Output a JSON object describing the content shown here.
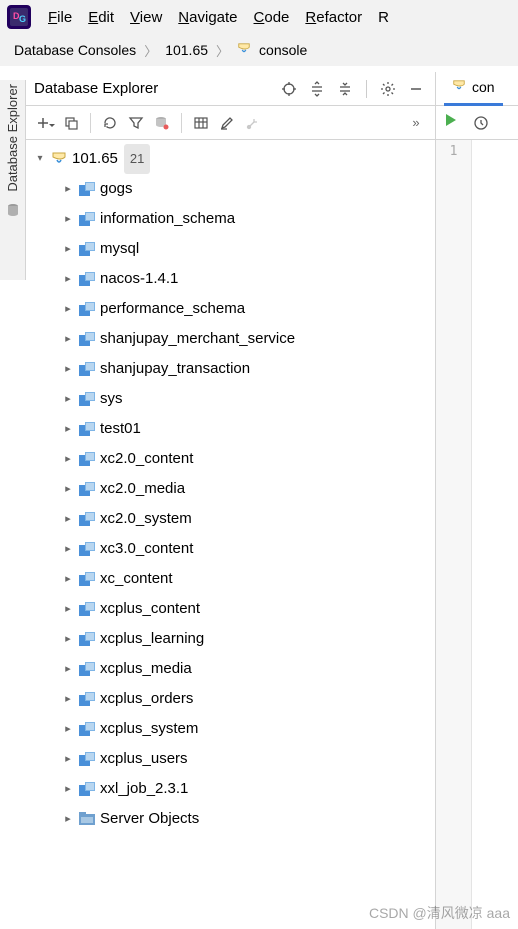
{
  "menu": {
    "items": [
      "File",
      "Edit",
      "View",
      "Navigate",
      "Code",
      "Refactor",
      "R"
    ]
  },
  "breadcrumb": {
    "root": "Database Consoles",
    "conn": "101.65",
    "file": "console"
  },
  "sidebar": {
    "label": "Database Explorer"
  },
  "panel": {
    "title": "Database Explorer"
  },
  "tree": {
    "connection": {
      "name": "101.65",
      "count": "21"
    },
    "schemas": [
      "gogs",
      "information_schema",
      "mysql",
      "nacos-1.4.1",
      "performance_schema",
      "shanjupay_merchant_service",
      "shanjupay_transaction",
      "sys",
      "test01",
      "xc2.0_content",
      "xc2.0_media",
      "xc2.0_system",
      "xc3.0_content",
      "xc_content",
      "xcplus_content",
      "xcplus_learning",
      "xcplus_media",
      "xcplus_orders",
      "xcplus_system",
      "xcplus_users",
      "xxl_job_2.3.1"
    ],
    "server_objects": "Server Objects"
  },
  "editor": {
    "tab": "con",
    "line1": "1"
  },
  "watermark": "CSDN @清风微凉 aaa"
}
